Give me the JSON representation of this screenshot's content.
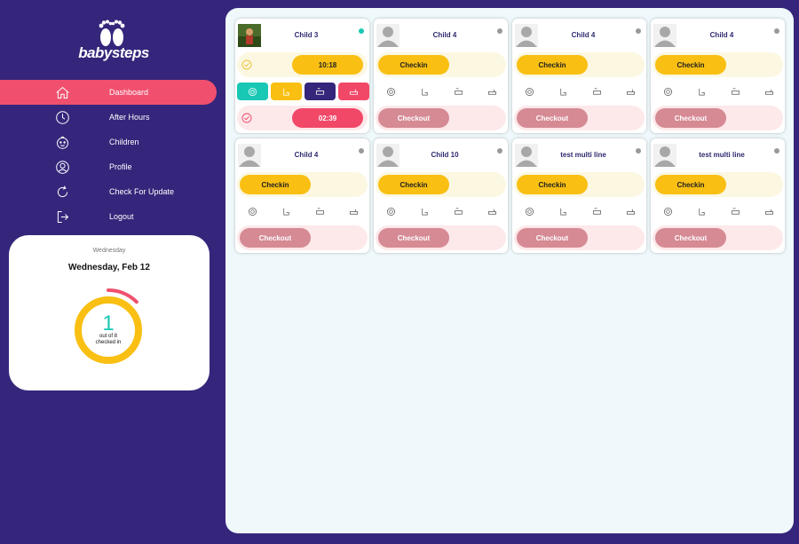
{
  "app": {
    "logo_text": "babysteps"
  },
  "nav": {
    "items": [
      {
        "label": "Dashboard",
        "icon": "home-icon",
        "active": true
      },
      {
        "label": "After Hours",
        "icon": "clock-icon",
        "active": false
      },
      {
        "label": "Children",
        "icon": "child-face-icon",
        "active": false
      },
      {
        "label": "Profile",
        "icon": "user-icon",
        "active": false
      },
      {
        "label": "Check For Update",
        "icon": "refresh-icon",
        "active": false
      },
      {
        "label": "Logout",
        "icon": "logout-icon",
        "active": false
      }
    ]
  },
  "summary": {
    "day": "Wednesday",
    "date": "Wednesday, Feb 12",
    "count": "1",
    "line1": "out of 8",
    "line2": "checked in",
    "checked_fraction": 0.125
  },
  "colors": {
    "sidebar_bg": "#35267b",
    "accent_pink": "#f0506e",
    "checkin_yellow": "#f9bf12",
    "checkout_muted": "#d58a94",
    "online_teal": "#18c8b4",
    "offline_gray": "#999999"
  },
  "children": [
    {
      "name": "Child 3",
      "photo": true,
      "online": true,
      "checked_in": true,
      "checkin_time": "10:18",
      "checkout_time": "02:39"
    },
    {
      "name": "Child 4",
      "photo": false,
      "online": false,
      "checked_in": false,
      "checkin_label": "Checkin",
      "checkout_label": "Checkout"
    },
    {
      "name": "Child 4",
      "photo": false,
      "online": false,
      "checked_in": false,
      "checkin_label": "Checkin",
      "checkout_label": "Checkout"
    },
    {
      "name": "Child 4",
      "photo": false,
      "online": false,
      "checked_in": false,
      "checkin_label": "Checkin",
      "checkout_label": "Checkout"
    },
    {
      "name": "Child 4",
      "photo": false,
      "online": false,
      "checked_in": false,
      "checkin_label": "Checkin",
      "checkout_label": "Checkout"
    },
    {
      "name": "Child 10",
      "photo": false,
      "online": false,
      "checked_in": false,
      "checkin_label": "Checkin",
      "checkout_label": "Checkout"
    },
    {
      "name": "test multi line",
      "photo": false,
      "online": false,
      "checked_in": false,
      "checkin_label": "Checkin",
      "checkout_label": "Checkout"
    },
    {
      "name": "test multi line",
      "photo": false,
      "online": false,
      "checked_in": false,
      "checkin_label": "Checkin",
      "checkout_label": "Checkout"
    }
  ],
  "activity_icons": [
    "meal-icon",
    "potty-icon",
    "nap-icon",
    "bath-icon"
  ]
}
